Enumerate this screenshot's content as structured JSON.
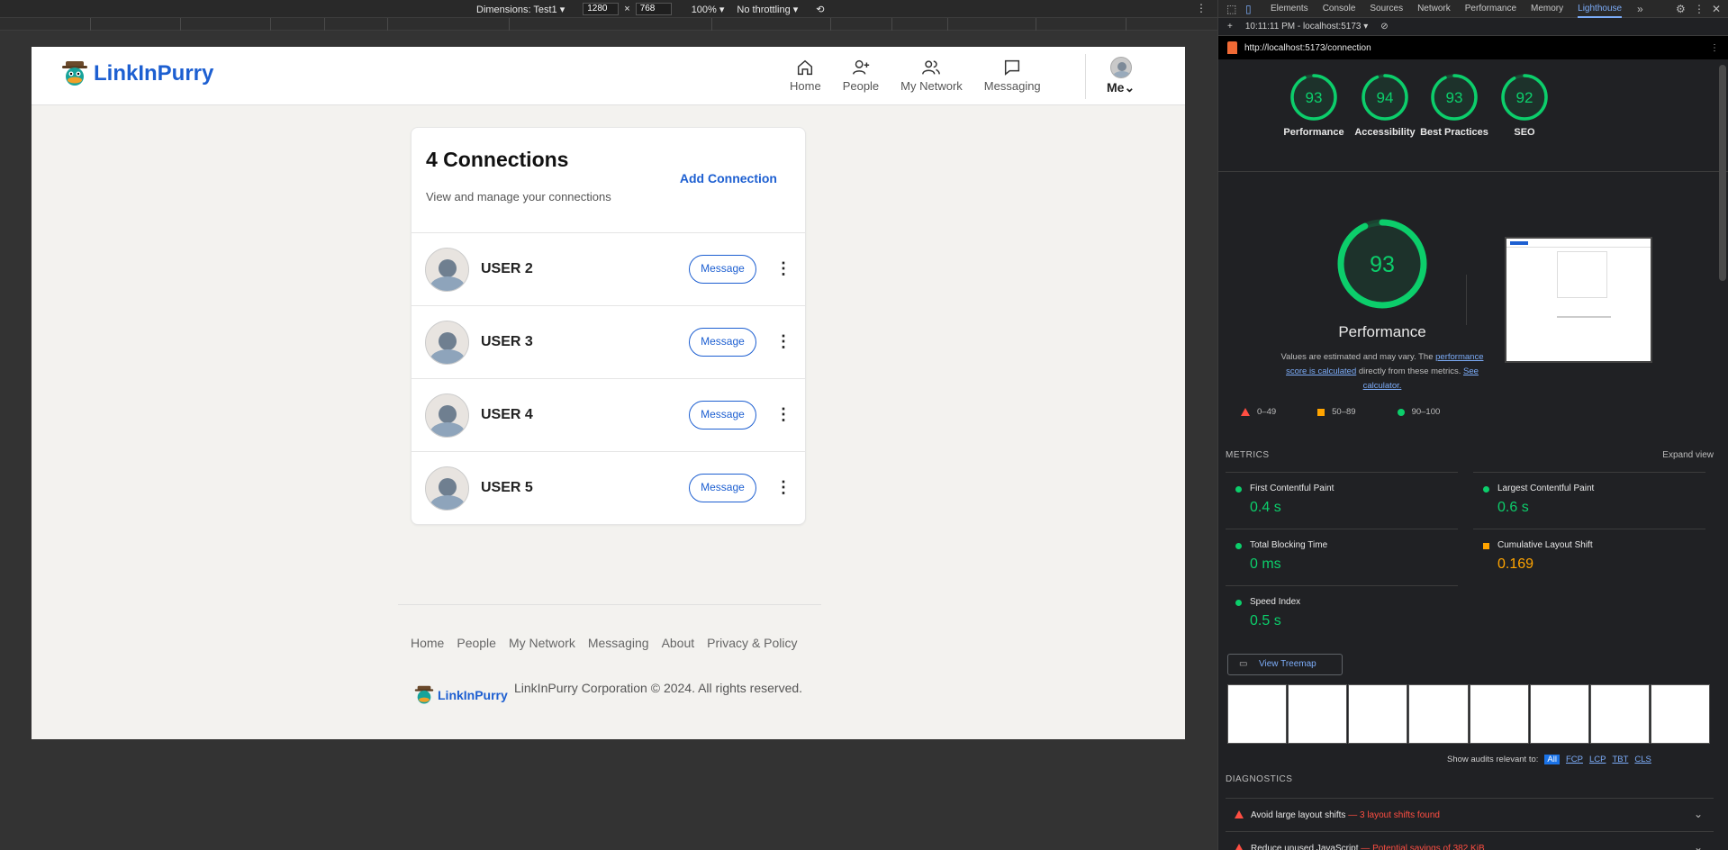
{
  "device_toolbar": {
    "dimensions_label": "Dimensions: Test1 ▾",
    "width": "1280",
    "height": "768",
    "zoom": "100% ▾",
    "throttling": "No throttling ▾",
    "times": "×"
  },
  "app": {
    "brand": "LinkInPurry",
    "nav": [
      {
        "label": "Home",
        "icon": "home-icon"
      },
      {
        "label": "People",
        "icon": "add-person-icon"
      },
      {
        "label": "My Network",
        "icon": "network-icon"
      },
      {
        "label": "Messaging",
        "icon": "message-icon"
      }
    ],
    "me_label": "Me",
    "me_caret": "⌄",
    "card": {
      "title": "4 Connections",
      "subtitle": "View and manage your connections",
      "add_button": "Add Connection"
    },
    "connections": [
      {
        "name": "USER 2",
        "action": "Message"
      },
      {
        "name": "USER 3",
        "action": "Message"
      },
      {
        "name": "USER 4",
        "action": "Message"
      },
      {
        "name": "USER 5",
        "action": "Message"
      }
    ],
    "footer": {
      "links": [
        "Home",
        "People",
        "My Network",
        "Messaging",
        "About",
        "Privacy & Policy"
      ],
      "brand": "LinkInPurry",
      "copyright": "LinkInPurry Corporation © 2024. All rights reserved."
    }
  },
  "devtools": {
    "tabs": [
      "Elements",
      "Console",
      "Sources",
      "Network",
      "Performance",
      "Memory",
      "Lighthouse"
    ],
    "active_tab": "Lighthouse",
    "report_time": "10:11:11 PM - localhost:5173 ▾",
    "url": "http://localhost:5173/connection",
    "scores": [
      {
        "label": "Performance",
        "value": 93
      },
      {
        "label": "Accessibility",
        "value": 94
      },
      {
        "label": "Best Practices",
        "value": 93
      },
      {
        "label": "SEO",
        "value": 92
      }
    ],
    "score_color": "#0cce6b",
    "performance": {
      "score": 93,
      "title": "Performance",
      "note_prefix": "Values are estimated and may vary. The ",
      "note_link1": "performance score is calculated",
      "note_mid": " directly from these metrics. ",
      "note_link2": "See calculator."
    },
    "legend": [
      "0–49",
      "50–89",
      "90–100"
    ],
    "metrics_heading": "METRICS",
    "expand_view": "Expand view",
    "metrics": [
      {
        "name": "First Contentful Paint",
        "value": "0.4 s",
        "status": "good"
      },
      {
        "name": "Largest Contentful Paint",
        "value": "0.6 s",
        "status": "good"
      },
      {
        "name": "Total Blocking Time",
        "value": "0 ms",
        "status": "good"
      },
      {
        "name": "Cumulative Layout Shift",
        "value": "0.169",
        "status": "average"
      },
      {
        "name": "Speed Index",
        "value": "0.5 s",
        "status": "good"
      }
    ],
    "view_treemap": "View Treemap",
    "show_audits_label": "Show audits relevant to:",
    "audit_filters": [
      "All",
      "FCP",
      "LCP",
      "TBT",
      "CLS"
    ],
    "diagnostics_heading": "DIAGNOSTICS",
    "diagnostics": [
      {
        "title": "Avoid large layout shifts",
        "detail": " — 3 layout shifts found"
      },
      {
        "title": "Reduce unused JavaScript",
        "detail": " — Potential savings of 382 KiB"
      }
    ]
  }
}
